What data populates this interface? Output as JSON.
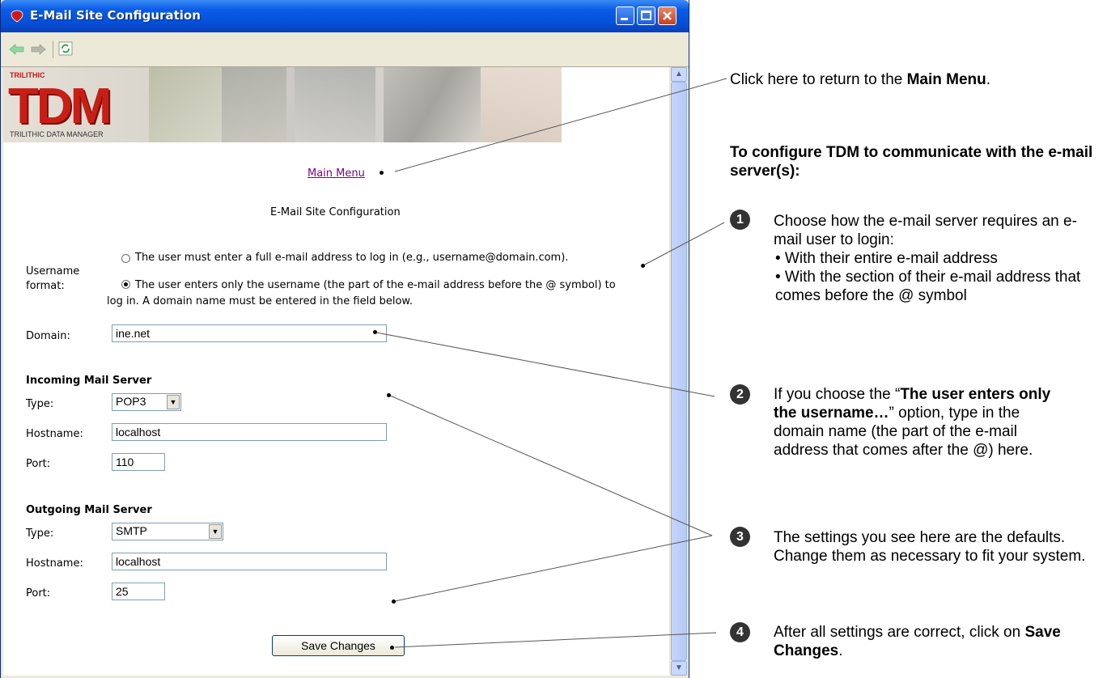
{
  "window": {
    "title": "E-Mail Site Configuration"
  },
  "toolbar": {
    "back_icon": "back-arrow-icon",
    "forward_icon": "forward-arrow-icon",
    "refresh_icon": "refresh-icon"
  },
  "banner": {
    "brand_top": "TRILITHIC",
    "logo_text": "TDM",
    "logo_sub": "TRILITHIC DATA MANAGER"
  },
  "page": {
    "main_menu_link": "Main Menu",
    "heading": "E-Mail Site Configuration",
    "username_format_label": "Username format:",
    "option_full": "The user must enter a full e-mail address to log in (e.g., username@domain.com).",
    "option_username": "The user enters only the username (the part of the e-mail address before the @ symbol) to log in. A domain name must be entered in the field below.",
    "domain_label": "Domain:",
    "domain_value": "ine.net",
    "incoming_heading": "Incoming Mail Server",
    "type_label": "Type:",
    "incoming_type": "POP3",
    "hostname_label": "Hostname:",
    "incoming_hostname": "localhost",
    "port_label": "Port:",
    "incoming_port": "110",
    "outgoing_heading": "Outgoing Mail Server",
    "outgoing_type": "SMTP",
    "outgoing_hostname": "localhost",
    "outgoing_port": "25",
    "save_button": "Save Changes"
  },
  "annotations": {
    "main_menu_note_prefix": "Click here to return to the ",
    "main_menu_note_bold": "Main Menu",
    "main_menu_note_suffix": ".",
    "heading": "To configure TDM to communicate with the e-mail server(s):",
    "step1_num": "1",
    "step1_text": "Choose how the e-mail server requires an e-mail user to login:",
    "step1_bullet1": "• With their entire e-mail address",
    "step1_bullet2": "• With the section of their e-mail address that comes before the @ symbol",
    "step2_num": "2",
    "step2_prefix": "If you choose the “",
    "step2_bold": "The user enters only the username…",
    "step2_suffix": "” option, type in the domain name (the part of the e-mail address that comes after the @) here.",
    "step3_num": "3",
    "step3_text": "The settings you see here are the defaults.  Change them as necessary to fit your system.",
    "step4_num": "4",
    "step4_prefix": "After all settings are correct, click on ",
    "step4_bold": "Save Changes",
    "step4_suffix": "."
  }
}
